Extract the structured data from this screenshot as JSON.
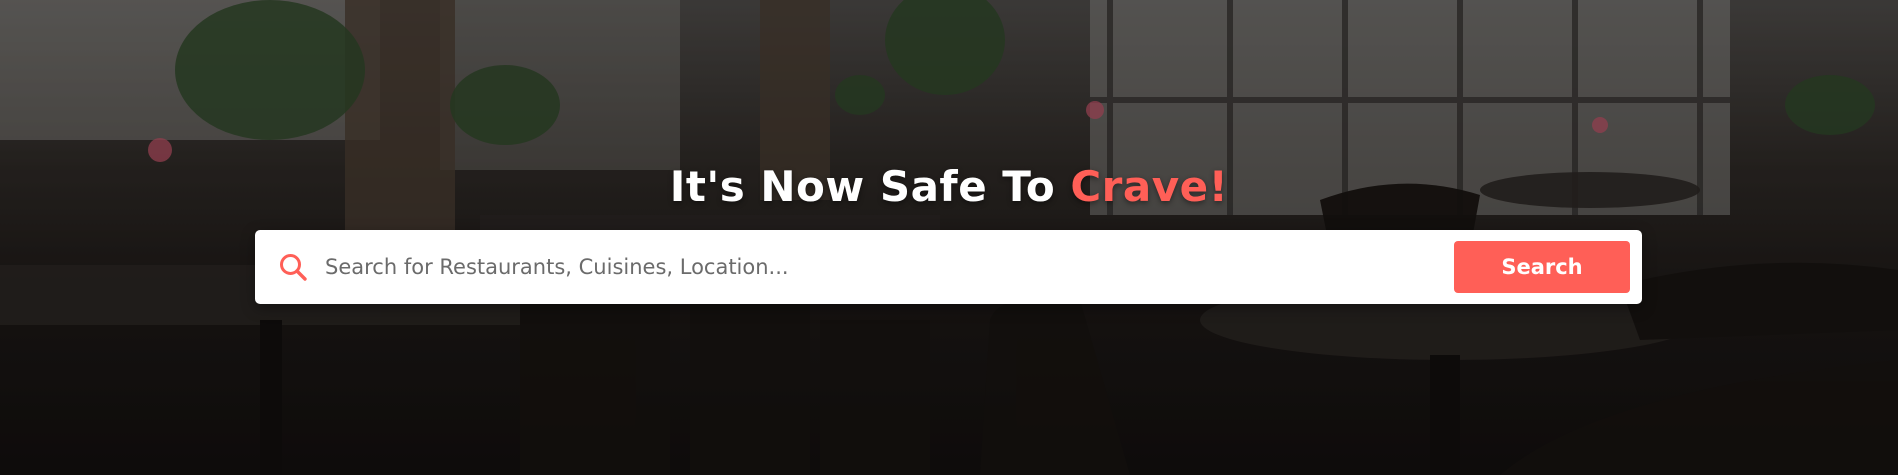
{
  "hero": {
    "title_main": "It's Now Safe To ",
    "title_accent": "Crave!",
    "accent_color": "#ff5f57",
    "background_image": "restaurant-interior"
  },
  "search": {
    "icon": "search-icon",
    "placeholder": "Search for Restaurants, Cuisines, Location...",
    "value": "",
    "button_label": "Search"
  }
}
